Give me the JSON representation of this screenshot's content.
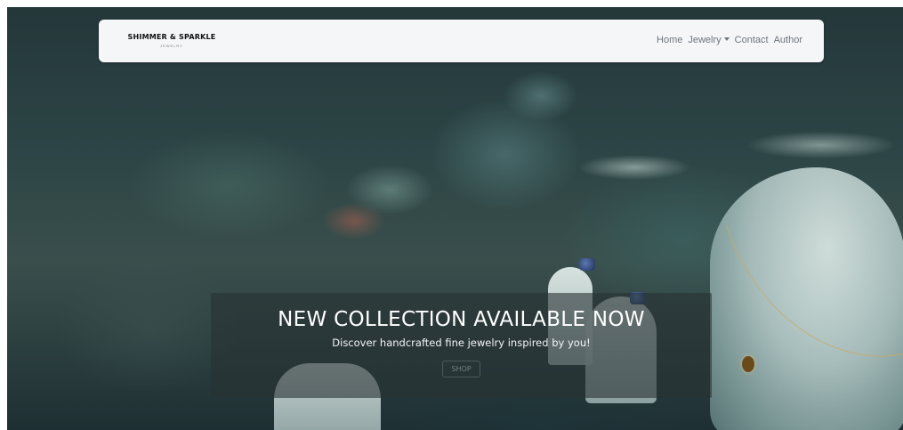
{
  "brand": {
    "name": "SHIMMER & SPARKLE",
    "tagline": "JEWELRY"
  },
  "nav": {
    "items": [
      {
        "label": "Home"
      },
      {
        "label": "Jewelry",
        "dropdown": true
      },
      {
        "label": "Contact"
      },
      {
        "label": "Author"
      }
    ]
  },
  "hero": {
    "title": "NEW COLLECTION AVAILABLE NOW",
    "subtitle": "Discover handcrafted fine jewelry inspired by you!",
    "button_label": "SHOP"
  },
  "colors": {
    "navbar_bg": "#f5f6f8",
    "nav_text": "#6c757d",
    "caption_bg": "rgba(40,50,52,0.6)"
  },
  "icons": {
    "dropdown": "caret-down-icon"
  }
}
